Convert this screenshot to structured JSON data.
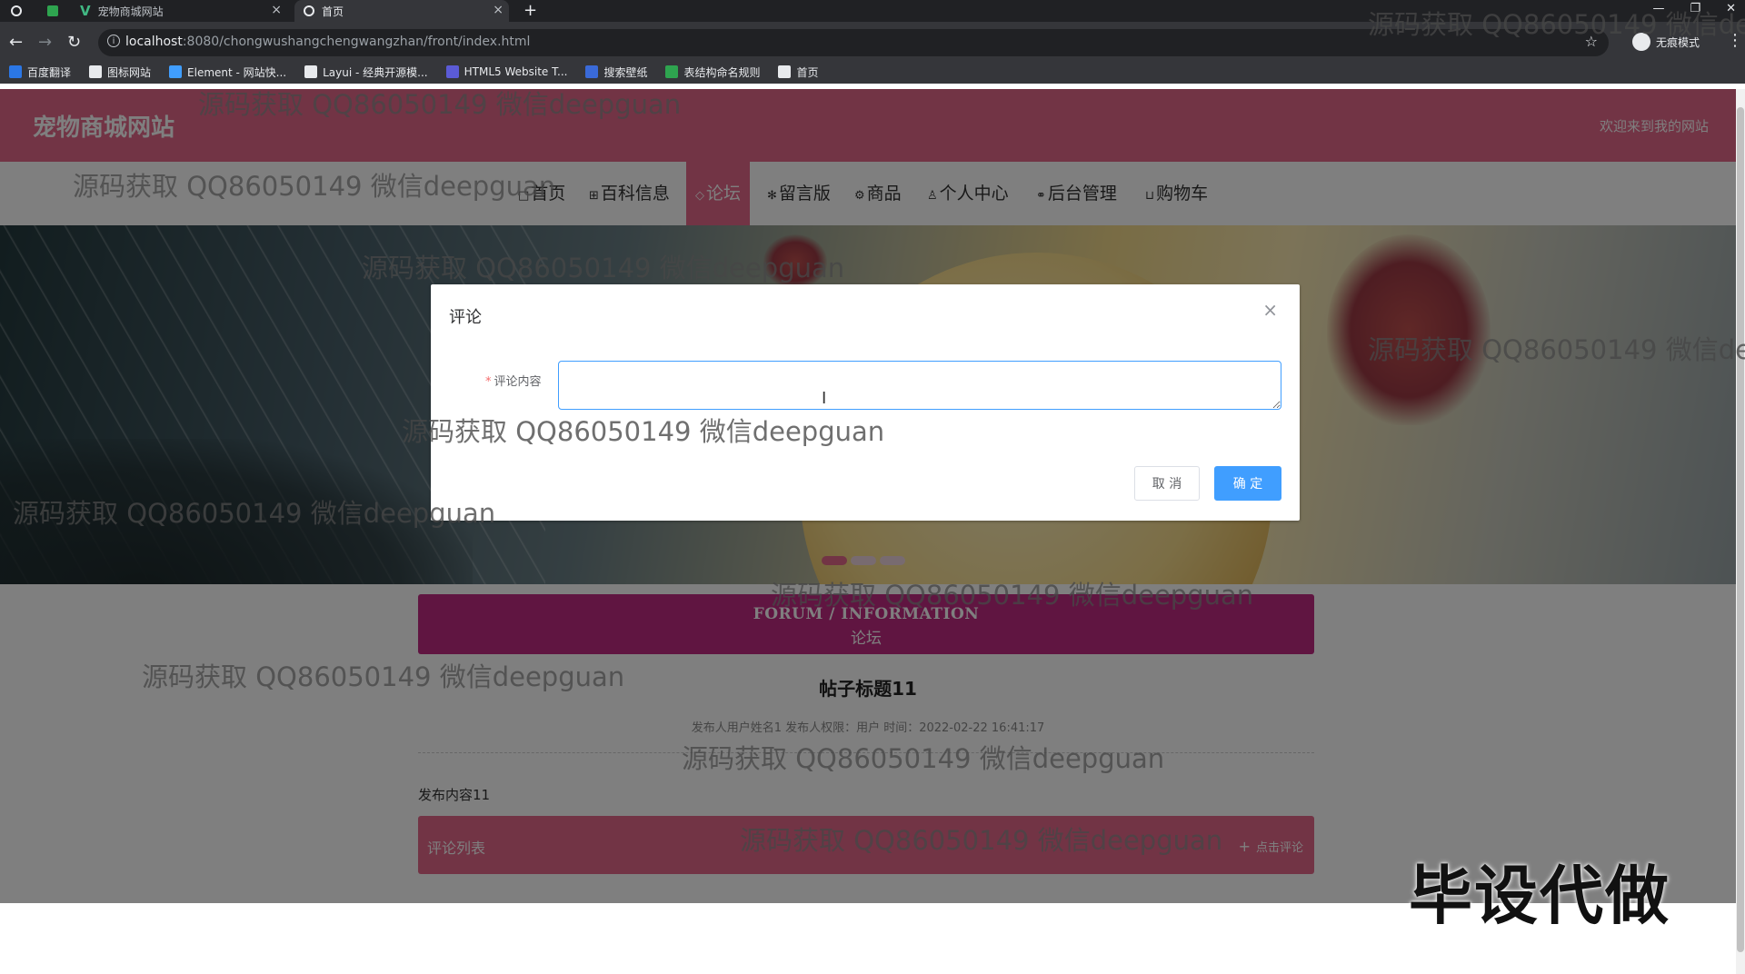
{
  "browser": {
    "tabs": [
      {
        "title": "",
        "icon": "globe-icon"
      },
      {
        "title": "",
        "icon": "green-app-icon"
      },
      {
        "title": "宠物商城网站",
        "icon": "vue-icon"
      },
      {
        "title": "首页",
        "icon": "globe-icon",
        "active": true
      }
    ],
    "new_tab": "+",
    "window_controls": [
      "—",
      "❐",
      "✕"
    ],
    "url_host": "localhost",
    "url_rest": ":8080/chongwushangchengwangzhan/front/index.html",
    "profile_label": "无痕模式",
    "bookmarks": [
      {
        "label": "百度翻译",
        "color": "#2b77e6"
      },
      {
        "label": "图标网站",
        "color": "#e8eaed"
      },
      {
        "label": "Element - 网站快...",
        "color": "#409eff"
      },
      {
        "label": "Layui - 经典开源模...",
        "color": "#e8eaed"
      },
      {
        "label": "HTML5 Website T...",
        "color": "#5b5bd6"
      },
      {
        "label": "搜索壁纸",
        "color": "#3a6ad8"
      },
      {
        "label": "表结构命名规则",
        "color": "#2ea44f"
      },
      {
        "label": "首页",
        "color": "#e8eaed"
      }
    ]
  },
  "site": {
    "logo": "宠物商城网站",
    "welcome": "欢迎来到我的网站",
    "accent": "#e4688b",
    "nav": [
      {
        "label": "首页",
        "icon": "□"
      },
      {
        "label": "百科信息",
        "icon": "⊞"
      },
      {
        "label": "论坛",
        "icon": "◇",
        "active": true
      },
      {
        "label": "留言版",
        "icon": "✻"
      },
      {
        "label": "商品",
        "icon": "⚙"
      },
      {
        "label": "个人中心",
        "icon": "♙"
      },
      {
        "label": "后台管理",
        "icon": "⚭"
      },
      {
        "label": "购物车",
        "icon": "⊔"
      }
    ]
  },
  "forum": {
    "title_en": "FORUM / INFORMATION",
    "title_cn": "论坛",
    "post_title": "帖子标题11",
    "post_meta": "发布人用户姓名1   发布人权限：用户   时间：2022-02-22 16:41:17",
    "post_content": "发布内容11",
    "comment_list_label": "评论列表",
    "add_comment_label": "点击评论"
  },
  "dialog": {
    "title": "评论",
    "field_label": "评论内容",
    "field_value": "",
    "cancel_label": "取 消",
    "confirm_label": "确 定"
  },
  "watermark": {
    "text": "源码获取 QQ86050149 微信deepguan",
    "promo": "毕设代做"
  }
}
